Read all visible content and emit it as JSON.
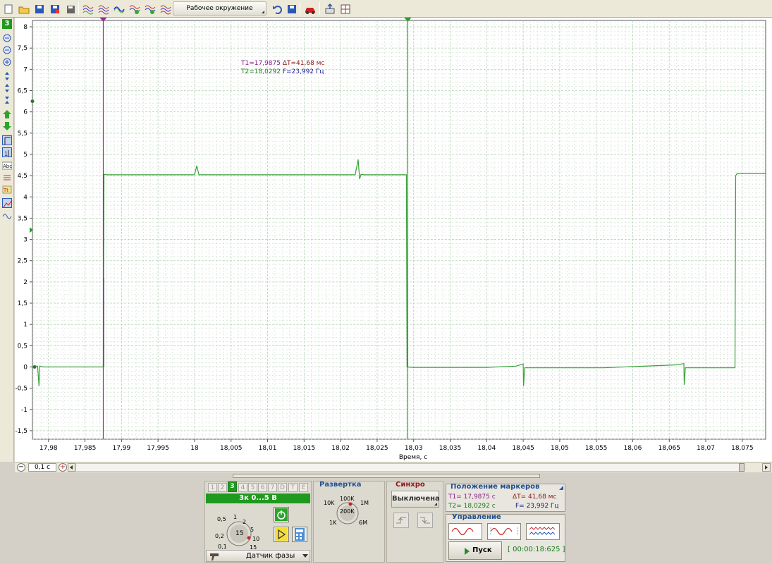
{
  "toolbar": {
    "workspace_label": "Рабочее окружение",
    "icons": [
      "open-file-icon",
      "save-icon",
      "save-as-icon",
      "save-all-icon",
      "print-icon",
      "waveform-1-icon",
      "waveform-2-icon",
      "waveform-3-icon",
      "waveform-4-icon",
      "waveform-5-icon",
      "waveform-6-icon",
      "undo-icon",
      "save-workspace-icon",
      "car-icon",
      "export-icon",
      "grid-icon"
    ]
  },
  "left_tools": {
    "channel_badge": "3",
    "icons": [
      "zoom-out-icon",
      "zoom-in-icon",
      "zoom-fit-icon",
      "stretch-icon",
      "shift-icon",
      "compress-icon",
      "move-up-icon",
      "move-down-icon",
      "cursor-icon",
      "measure-icon",
      "text-icon",
      "bars-icon",
      "text-marker-icon",
      "chart-view-icon",
      "wave-view-icon"
    ]
  },
  "chart_data": {
    "type": "line",
    "xlabel": "Время, с",
    "ylabel": "",
    "xlim": [
      17.9778,
      18.0782
    ],
    "ylim": [
      -1.7,
      8.15
    ],
    "x_ticks": [
      "17,98",
      "17,985",
      "17,99",
      "17,995",
      "18",
      "18,005",
      "18,01",
      "18,015",
      "18,02",
      "18,025",
      "18,03",
      "18,035",
      "18,04",
      "18,045",
      "18,05",
      "18,055",
      "18,06",
      "18,065",
      "18,07",
      "18,075"
    ],
    "x_tick_values": [
      17.98,
      17.985,
      17.99,
      17.995,
      18.0,
      18.005,
      18.01,
      18.015,
      18.02,
      18.025,
      18.03,
      18.035,
      18.04,
      18.045,
      18.05,
      18.055,
      18.06,
      18.065,
      18.07,
      18.075
    ],
    "y_ticks": [
      "8",
      "7,5",
      "7",
      "6,5",
      "6",
      "5,5",
      "5",
      "4,5",
      "4",
      "3,5",
      "3",
      "2,5",
      "2",
      "1,5",
      "1",
      "0,5",
      "0",
      "-0,5",
      "-1",
      "-1,5"
    ],
    "y_tick_values": [
      8,
      7.5,
      7,
      6.5,
      6,
      5.5,
      5,
      4.5,
      4,
      3.5,
      3,
      2.5,
      2,
      1.5,
      1,
      0.5,
      0,
      -0.5,
      -1,
      -1.5
    ],
    "grid": true,
    "series": [
      {
        "color": "#3aa23a",
        "x": [
          17.9782,
          17.9785,
          17.9787,
          17.9788,
          17.9792,
          17.9875,
          17.9876,
          17.988,
          17.991,
          18.0,
          18.0003,
          18.0006,
          18.001,
          18.01,
          18.02,
          18.022,
          18.0224,
          18.0226,
          18.0228,
          18.0232,
          18.024,
          18.029,
          18.0291,
          18.03,
          18.04,
          18.044,
          18.045,
          18.04505,
          18.0452,
          18.046,
          18.056,
          18.066,
          18.067,
          18.06705,
          18.0672,
          18.068,
          18.074,
          18.0741,
          18.0743,
          18.076,
          18.0782
        ],
        "y": [
          0.02,
          0.02,
          -0.45,
          0.02,
          0.0,
          0.0,
          4.53,
          4.52,
          4.52,
          4.52,
          4.73,
          4.52,
          4.52,
          4.52,
          4.52,
          4.52,
          4.88,
          4.42,
          4.53,
          4.52,
          4.52,
          4.52,
          0.0,
          -0.01,
          -0.01,
          0.02,
          0.07,
          -0.45,
          -0.02,
          -0.02,
          -0.02,
          0.05,
          0.08,
          -0.42,
          -0.02,
          -0.02,
          -0.02,
          4.5,
          4.55,
          4.55,
          4.55
        ]
      },
      {
        "color": "#000000",
        "x": [
          17.98755,
          17.98755
        ],
        "y": [
          0.0,
          2.1
        ]
      }
    ],
    "markers": [
      {
        "name": "T1",
        "x": 17.9875,
        "color": "#9b2a9b"
      },
      {
        "name": "T2",
        "x": 18.0292,
        "color": "#2e9a2e"
      }
    ],
    "readout": {
      "t1": "T1=17,9875",
      "dt": "ΔT=41,68 мс",
      "t2": "T2=18,0292",
      "f": "F=23,992 Гц"
    }
  },
  "hscroll": {
    "zoom_value": "0,1 с"
  },
  "channel_panel": {
    "tabs": [
      "1",
      "2",
      "3",
      "4",
      "5",
      "6",
      "7",
      "D",
      "T",
      "E"
    ],
    "active_tab": "3",
    "range": "3к 0...5 В",
    "knob_labels": [
      "0,5",
      "1",
      "2",
      "5",
      "10",
      "15",
      "0,2",
      "0,1"
    ],
    "knob_value": "15",
    "sensor": "Датчик фазы"
  },
  "sweep_panel": {
    "title": "Развертка",
    "knob_labels": [
      "100K",
      "1M",
      "6M",
      "1K",
      "10K"
    ],
    "knob_value": "200K"
  },
  "sync_panel": {
    "title": "Синхро",
    "mode": "Выключена"
  },
  "markers_panel": {
    "title": "Положение маркеров",
    "t1": "T1= 17,9875 с",
    "dt": "ΔT= 41,68 мс",
    "t2": "T2= 18,0292 с",
    "f": "F= 23,992 Гц"
  },
  "control_panel": {
    "title": "Управление",
    "run_label": "Пуск",
    "elapsed": "[ 00:00:18:625 ]"
  }
}
